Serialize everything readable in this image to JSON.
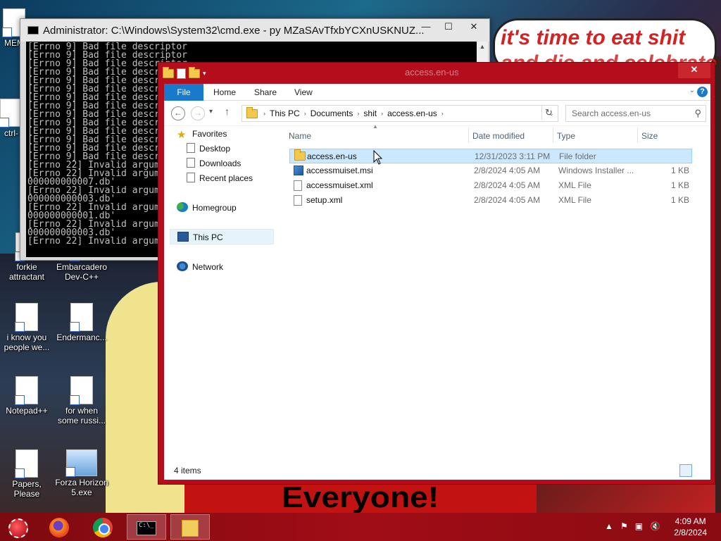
{
  "wallpaper": {
    "bubble_line1": "it's time to eat shit",
    "bubble_line2": "and die and celebrate",
    "banner": "Everyone!"
  },
  "desktop_icons": [
    {
      "label": "MEM"
    },
    {
      "label": "ctrl-"
    },
    {
      "label": "forkie attractant"
    },
    {
      "label": "Embarcadero Dev-C++"
    },
    {
      "label": "i know you people we..."
    },
    {
      "label": "Endermanc..."
    },
    {
      "label": "Notepad++"
    },
    {
      "label": "for when some russi..."
    },
    {
      "label": "Papers, Please"
    },
    {
      "label": "Forza Horizon 5.exe"
    }
  ],
  "cmd": {
    "title": "Administrator: C:\\Windows\\System32\\cmd.exe - py  MZaSAvTfxbYCXnUSKNUZ...",
    "min": "—",
    "max": "☐",
    "close": "✕",
    "output": "[Errno 9] Bad file descriptor\n[Errno 9] Bad file descriptor\n[Errno 9] Bad file descriptor\n[Errno 9] Bad file descr\n[Errno 9] Bad file descr\n[Errno 9] Bad file descr\n[Errno 9] Bad file descr\n[Errno 9] Bad file descr\n[Errno 9] Bad file descr\n[Errno 9] Bad file descr\n[Errno 9] Bad file descr\n[Errno 9] Bad file descr\n[Errno 9] Bad file descr\n[Errno 9] Bad file descr\n[Errno 22] Invalid argum\n[Errno 22] Invalid argum\n000000000007.db'\n[Errno 22] Invalid argum\n000000000003.db'\n[Errno 22] Invalid argum\n000000000001.db'\n[Errno 22] Invalid argum\n000000000003.db'\n[Errno 22] Invalid argum"
  },
  "explorer": {
    "title": "access.en-us",
    "close": "✕",
    "ribbon": {
      "file": "File",
      "home": "Home",
      "share": "Share",
      "view": "View",
      "help": "?"
    },
    "nav": {
      "back": "←",
      "forward": "→",
      "up": "↑",
      "dropdown": "⌄"
    },
    "breadcrumb": [
      "This PC",
      "Documents",
      "shit",
      "access.en-us"
    ],
    "refresh": "↻",
    "search_placeholder": "Search access.en-us",
    "navpane": {
      "favorites": "Favorites",
      "desktop": "Desktop",
      "downloads": "Downloads",
      "recent": "Recent places",
      "homegroup": "Homegroup",
      "thispc": "This PC",
      "network": "Network"
    },
    "columns": {
      "name": "Name",
      "date": "Date modified",
      "type": "Type",
      "size": "Size"
    },
    "files": [
      {
        "name": "access.en-us",
        "date": "12/31/2023 3:11 PM",
        "type": "File folder",
        "size": "",
        "icon": "folder-icon"
      },
      {
        "name": "accessmuiset.msi",
        "date": "2/8/2024 4:05 AM",
        "type": "Windows Installer ...",
        "size": "1 KB",
        "icon": "installer-icon"
      },
      {
        "name": "accessmuiset.xml",
        "date": "2/8/2024 4:05 AM",
        "type": "XML File",
        "size": "1 KB",
        "icon": "xml-file-icon"
      },
      {
        "name": "setup.xml",
        "date": "2/8/2024 4:05 AM",
        "type": "XML File",
        "size": "1 KB",
        "icon": "xml-file-icon"
      }
    ],
    "status": "4 items"
  },
  "taskbar": {
    "tray_up": "▲",
    "clock_time": "4:09 AM",
    "clock_date": "2/8/2024",
    "cmd_prompt": "C:\\_"
  },
  "colors": {
    "accent": "#b50d1c",
    "taskbar": "#a10d16",
    "selection": "#cce8ff",
    "file_tab": "#1979ca"
  }
}
